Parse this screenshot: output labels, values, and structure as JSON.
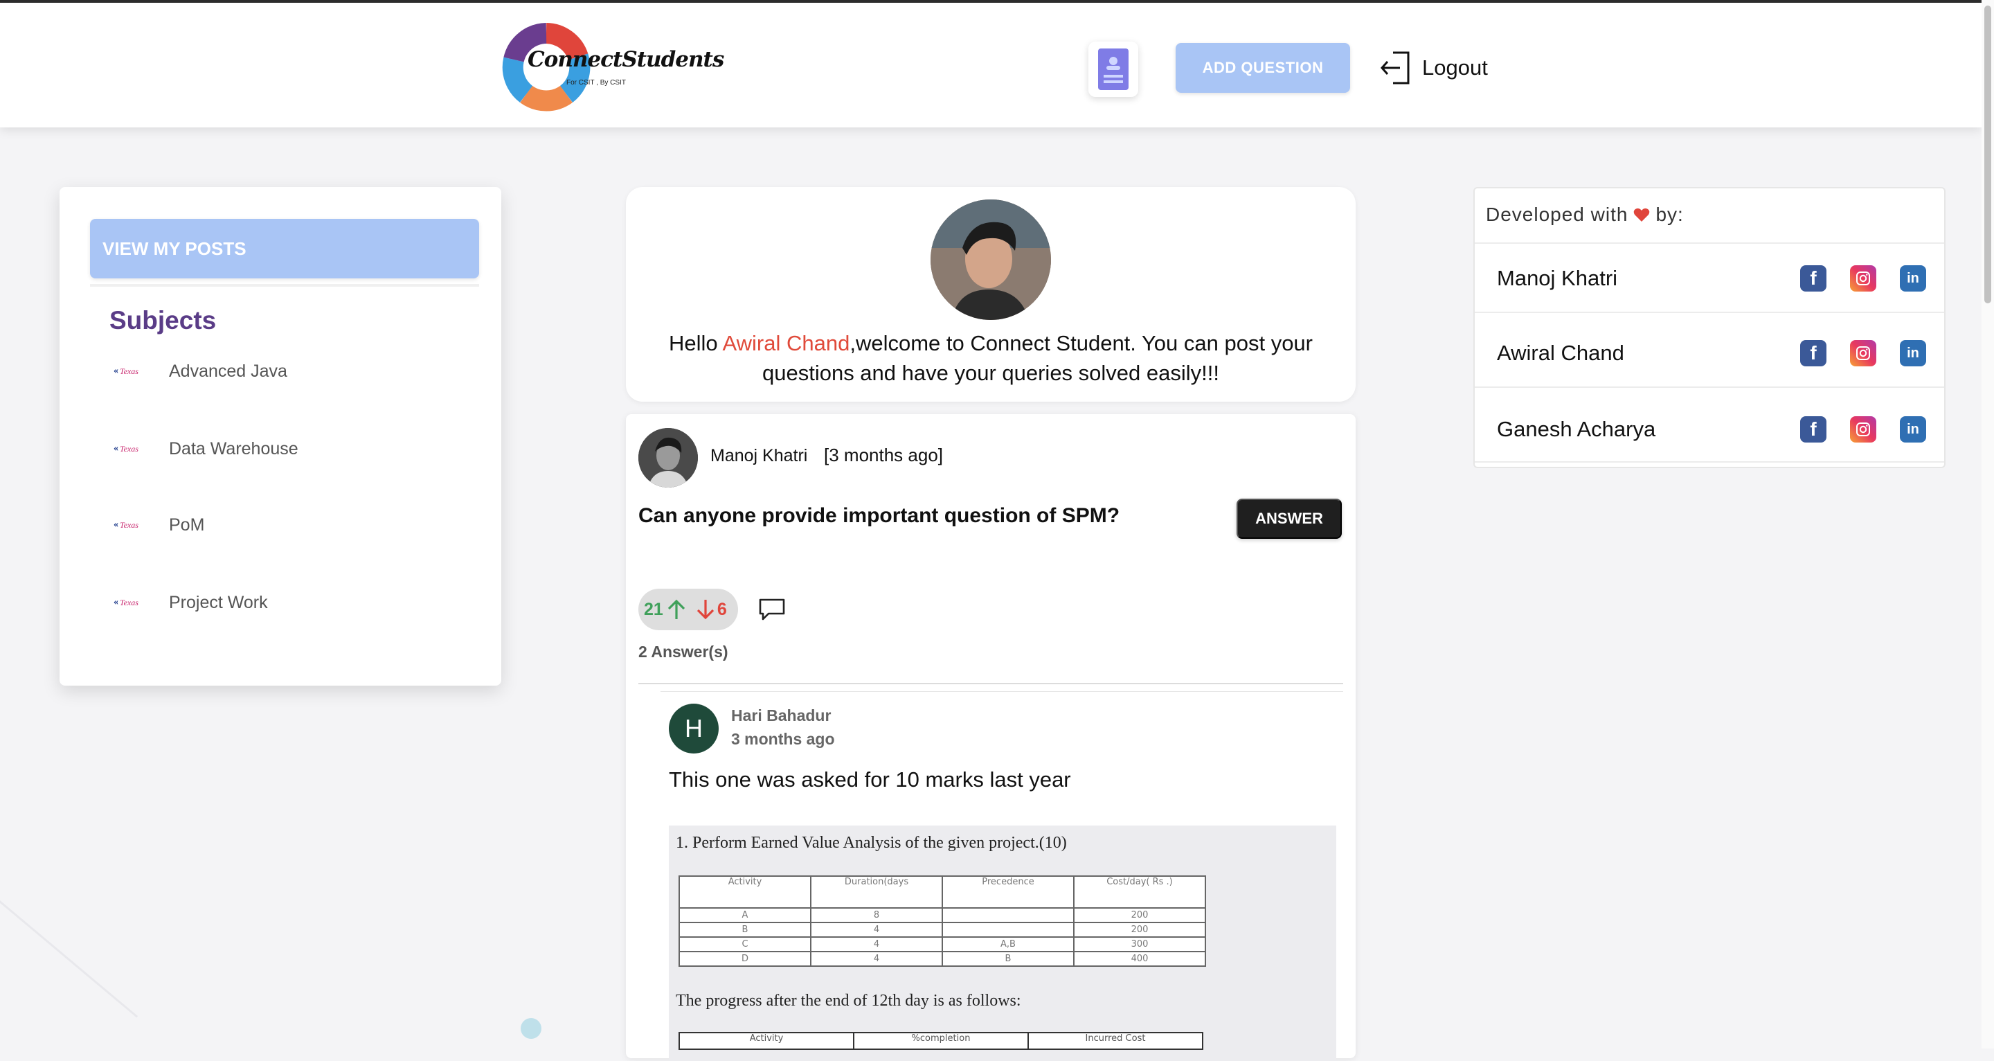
{
  "header": {
    "logo_text": "ConnectStudents",
    "logo_subtitle": "For CSIT , By CSIT",
    "add_question_label": "ADD QUESTION",
    "logout_label": "Logout"
  },
  "sidebar": {
    "view_posts_label": "VIEW MY POSTS",
    "subjects_title": "Subjects",
    "subject_logo_text": "Texas",
    "subjects": [
      {
        "label": "Advanced Java"
      },
      {
        "label": "Data Warehouse"
      },
      {
        "label": "PoM"
      },
      {
        "label": "Project Work"
      }
    ]
  },
  "welcome": {
    "prefix": "Hello ",
    "name": "Awiral Chand",
    "message": ",welcome to Connect Student. You can post your questions and have your queries solved easily!!!"
  },
  "post": {
    "author": "Manoj Khatri",
    "time": "[3 months ago]",
    "question": "Can anyone provide important question of SPM?",
    "answer_button": "ANSWER",
    "upvotes": "21",
    "downvotes": "6",
    "answers_count": "2 Answer(s)",
    "answer": {
      "avatar_letter": "H",
      "author": "Hari Bahadur",
      "time": "3 months ago",
      "text": "This one was asked for 10 marks last year",
      "image_line1": "1. Perform Earned Value Analysis of the given project.(10)",
      "image_line2": "The progress after the end of 12th day is as follows:",
      "table_headers": [
        "Activity",
        "Duration(days",
        "Precedence",
        "Cost/day( Rs .)"
      ],
      "table_rows": [
        [
          "A",
          "8",
          "",
          "200"
        ],
        [
          "B",
          "4",
          "",
          "200"
        ],
        [
          "C",
          "4",
          "A,B",
          "300"
        ],
        [
          "D",
          "4",
          "B",
          "400"
        ]
      ],
      "table2_headers": [
        "Activity",
        "%completion",
        "Incurred Cost"
      ]
    }
  },
  "developers": {
    "title_prefix": "Developed with",
    "title_suffix": "by:",
    "people": [
      {
        "name": "Manoj Khatri"
      },
      {
        "name": "Awiral Chand"
      },
      {
        "name": "Ganesh Acharya"
      }
    ]
  },
  "colors": {
    "accent_button": "#a9c5f5",
    "subjects_title": "#5a3c87",
    "highlight_name": "#e04a3a",
    "upvote": "#3fa05a",
    "downvote": "#e0453b"
  },
  "icons": [
    "document-icon",
    "logout-icon",
    "arrow-up-icon",
    "arrow-down-icon",
    "comment-icon",
    "heart-icon",
    "facebook-icon",
    "instagram-icon",
    "linkedin-icon"
  ]
}
